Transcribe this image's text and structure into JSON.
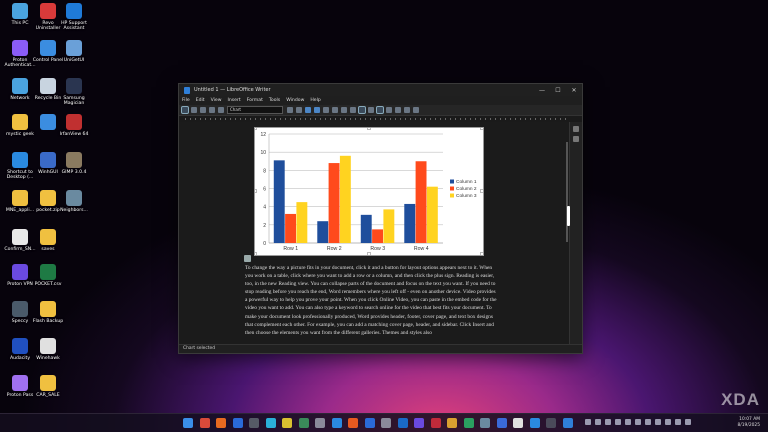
{
  "desktop": {
    "icons": [
      {
        "label": "This PC",
        "icon": "monitor-icon",
        "color": "#4aa3df"
      },
      {
        "label": "Revo Uninstaller",
        "icon": "revo-icon",
        "color": "#d93a3a"
      },
      {
        "label": "HP Support Assistant",
        "icon": "help-icon",
        "color": "#1f7ad8"
      },
      {
        "label": "Proton Authenticat...",
        "icon": "proton-auth-icon",
        "color": "#8a5cf6"
      },
      {
        "label": "Control Panel",
        "icon": "control-panel-icon",
        "color": "#3b8de0"
      },
      {
        "label": "UniGetUI",
        "icon": "unigetui-icon",
        "color": "#6aa0d8"
      },
      {
        "label": "Network",
        "icon": "network-icon",
        "color": "#4aa3df"
      },
      {
        "label": "Recycle Bin",
        "icon": "recycle-bin-icon",
        "color": "#c8d4e0"
      },
      {
        "label": "Samsung Magician",
        "icon": "samsung-magician-icon",
        "color": "#2a3550"
      },
      {
        "label": "mystic geek",
        "icon": "folder-icon",
        "color": "#f0c040"
      },
      {
        "label": "",
        "icon": "control-panel-icon",
        "color": "#3b8de0"
      },
      {
        "label": "IrfanView 64",
        "icon": "irfanview-icon",
        "color": "#c03030"
      },
      {
        "label": "Shortcut to Desktop (...",
        "icon": "onedrive-icon",
        "color": "#2a8ae0"
      },
      {
        "label": "WinhGUI",
        "icon": "winhgui-icon",
        "color": "#3a6ac8"
      },
      {
        "label": "GIMP 3.0.4",
        "icon": "gimp-icon",
        "color": "#8a7a60"
      },
      {
        "label": "MNE_appli...",
        "icon": "folder-icon",
        "color": "#f0c040"
      },
      {
        "label": "pocket.zip",
        "icon": "zip-folder-icon",
        "color": "#f0c040"
      },
      {
        "label": "Neighbors...",
        "icon": "image-file-icon",
        "color": "#6a8aa0"
      },
      {
        "label": "Confirm_SN...",
        "icon": "document-icon",
        "color": "#e8e8e8"
      },
      {
        "label": "saves",
        "icon": "folder-icon",
        "color": "#f0c040"
      },
      {
        "label": "Proton VPN",
        "icon": "proton-vpn-icon",
        "color": "#6a4ae0"
      },
      {
        "label": "POCKET.csv",
        "icon": "excel-icon",
        "color": "#1e7a44"
      },
      {
        "label": "Speccy",
        "icon": "speccy-icon",
        "color": "#4a5a6a"
      },
      {
        "label": "Flash Backup",
        "icon": "folder-icon",
        "color": "#f0c040"
      },
      {
        "label": "Audacity",
        "icon": "audacity-icon",
        "color": "#2050c0"
      },
      {
        "label": "Winehawk",
        "icon": "winehawk-icon",
        "color": "#e0e0e0"
      },
      {
        "label": "Proton Pass",
        "icon": "proton-pass-icon",
        "color": "#a070f0"
      },
      {
        "label": "CAR_SALE",
        "icon": "folder-icon",
        "color": "#f0c040"
      }
    ]
  },
  "window": {
    "title": "Untitled 1 — LibreOffice Writer",
    "controls": {
      "minimize": "—",
      "maximize": "☐",
      "close": "✕"
    },
    "menu": [
      "File",
      "Edit",
      "View",
      "Insert",
      "Format",
      "Tools",
      "Window",
      "Help"
    ],
    "namebox": "Chart",
    "status": "Chart selected"
  },
  "document": {
    "paragraph": "To change the way a picture fits in your document, click it and a button for layout options appears next to it. When you work on a table, click where you want to add a row or a column, and then click the plus sign. Reading is easier, too, in the new Reading view. You can collapse parts of the document and focus on the text you want. If you need to stop reading before you reach the end, Word remembers where you left off - even on another device. Video provides a powerful way to help you prove your point. When you click Online Video, you can paste in the embed code for the video you want to add. You can also type a keyword to search online for the video that best fits your document. To make your document look professionally produced, Word provides header, footer, cover page, and text box designs that complement each other. For example, you can add a matching cover page, header, and sidebar. Click Insert and then choose the elements you want from the different galleries. Themes and styles also"
  },
  "chart_data": {
    "type": "bar",
    "categories": [
      "Row 1",
      "Row 2",
      "Row 3",
      "Row 4"
    ],
    "series": [
      {
        "name": "Column 1",
        "values": [
          9.1,
          2.4,
          3.1,
          4.3
        ],
        "color": "#1f4e9c"
      },
      {
        "name": "Column 2",
        "values": [
          3.2,
          8.8,
          1.5,
          9.0
        ],
        "color": "#ff4a1c"
      },
      {
        "name": "Column 3",
        "values": [
          4.5,
          9.6,
          3.7,
          6.2
        ],
        "color": "#ffd320"
      }
    ],
    "ylim": [
      0,
      12
    ],
    "yticks": [
      0,
      2,
      4,
      6,
      8,
      10,
      12
    ],
    "grid": true,
    "legend": "right",
    "title": "",
    "xlabel": "",
    "ylabel": ""
  },
  "taskbar": {
    "apps": [
      {
        "icon": "start-icon",
        "color": "#3a8ee8"
      },
      {
        "icon": "app-icon",
        "color": "#d84a3a"
      },
      {
        "icon": "firefox-icon",
        "color": "#e86a20"
      },
      {
        "icon": "outlook-icon",
        "color": "#2a6ad8"
      },
      {
        "icon": "app-icon",
        "color": "#555a66"
      },
      {
        "icon": "edge-icon",
        "color": "#2ab0d8"
      },
      {
        "icon": "chrome-icon",
        "color": "#d8c030"
      },
      {
        "icon": "app-icon",
        "color": "#3a8a5a"
      },
      {
        "icon": "app-icon",
        "color": "#8a8a9a"
      },
      {
        "icon": "app-icon",
        "color": "#2a8ae0"
      },
      {
        "icon": "app-icon",
        "color": "#e85a20"
      },
      {
        "icon": "app-icon",
        "color": "#2a6ad8"
      },
      {
        "icon": "settings-icon",
        "color": "#8a8a9a"
      },
      {
        "icon": "app-icon",
        "color": "#1a6ac8"
      },
      {
        "icon": "app-icon",
        "color": "#6a4ae0"
      },
      {
        "icon": "app-icon",
        "color": "#c02a3a"
      },
      {
        "icon": "app-icon",
        "color": "#d8a030"
      },
      {
        "icon": "app-icon",
        "color": "#2aa060"
      },
      {
        "icon": "app-icon",
        "color": "#6a8aa0"
      },
      {
        "icon": "app-icon",
        "color": "#3a6ad8"
      },
      {
        "icon": "app-icon",
        "color": "#e0e0e0"
      },
      {
        "icon": "app-icon",
        "color": "#2a8ae0"
      },
      {
        "icon": "app-icon",
        "color": "#4a4a5a"
      },
      {
        "icon": "writer-icon",
        "color": "#2f7fd8"
      }
    ],
    "time": "10:07 AM",
    "date": "8/19/2025"
  },
  "watermark": "XDA"
}
